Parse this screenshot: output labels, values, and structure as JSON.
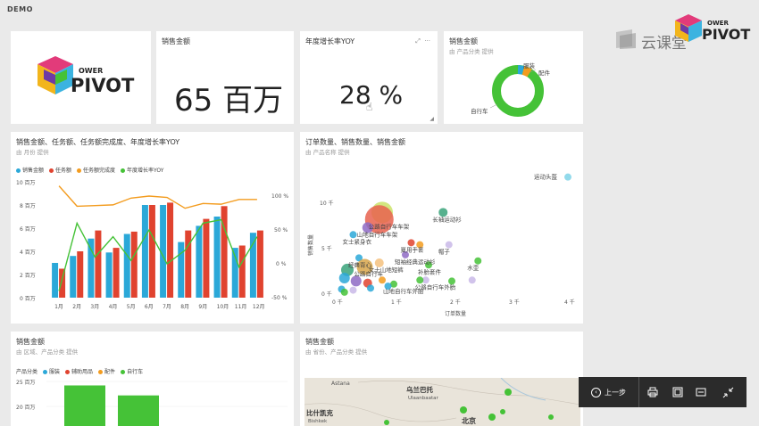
{
  "app": {
    "title": "DEMO"
  },
  "watermark": {
    "text": "云课堂",
    "brand_top": "OWER",
    "brand_main": "PIVOT",
    "brand_sub": "工坊"
  },
  "logo_tile": {
    "brand_top": "OWER",
    "brand_main": "PIVOT",
    "brand_sub": "工坊"
  },
  "kpi_sales": {
    "title": "销售金额",
    "value": "65 百万"
  },
  "kpi_growth": {
    "title": "年度增长率YOY",
    "value": "28 %"
  },
  "donut": {
    "title": "销售金额",
    "subtitle": "由 产品分类 提供",
    "labels": [
      "服装",
      "配件",
      "自行车"
    ],
    "colors": {
      "bike": "#45c237",
      "clothing": "#2ba8d8",
      "accessory": "#f39c1f"
    }
  },
  "combo": {
    "title": "销售金额、任务额、任务额完成度、年度增长率YOY",
    "subtitle": "由 月份 提供",
    "legend": [
      "销售金额",
      "任务额",
      "任务额完成度",
      "年度增长率YOY"
    ],
    "y_left_ticks": [
      "10 百万",
      "8 百万",
      "6 百万",
      "4 百万",
      "2 百万",
      "0 百万"
    ],
    "y_right_ticks": [
      "100 %",
      "50 %",
      "0 %",
      "-50 %"
    ]
  },
  "scatter": {
    "title": "订单数量、销售数量、销售金额",
    "subtitle": "由 产品名称 提供",
    "xlabel": "订单数量",
    "ylabel": "销售数量",
    "x_ticks": [
      "0 千",
      "1 千",
      "2 千",
      "3 千",
      "4 千"
    ],
    "y_ticks": [
      "10 千",
      "5 千",
      "0 千"
    ],
    "labels": [
      "运动头盔",
      "长袖运动衫",
      "公路自行车车架",
      "山地自行车车架",
      "女士紧身衣",
      "夏用手套",
      "短袖经典运动衫",
      "帽子",
      "经典背心",
      "女士山地短裤",
      "公路自行车",
      "补胎套件",
      "水壶",
      "公路自行车外胎",
      "山地自行车外胎",
      "运动水壶",
      "山地自行车"
    ]
  },
  "bar_bottom": {
    "title": "销售金额",
    "subtitle": "由 区域、产品分类 提供",
    "legend_title": "产品分类",
    "legend": [
      "服装",
      "辅助用品",
      "配件",
      "自行车"
    ],
    "y_ticks": [
      "25 百万",
      "20 百万"
    ]
  },
  "map_tile": {
    "title": "销售金额",
    "subtitle": "由 省份、产品分类 提供",
    "places": [
      "Astana",
      "乌兰巴托",
      "Ulaanbaatar",
      "比什凯克",
      "Bishkek",
      "北京"
    ]
  },
  "nav": {
    "back_label": "上一步"
  },
  "chart_data": [
    {
      "type": "bar",
      "title": "销售金额、任务额、任务额完成度、年度增长率YOY",
      "categories": [
        "1月",
        "2月",
        "3月",
        "4月",
        "5月",
        "6月",
        "7月",
        "8月",
        "9月",
        "10月",
        "11月",
        "12月"
      ],
      "ylim": [
        0,
        10
      ],
      "y2lim": [
        -50,
        100
      ],
      "series": [
        {
          "name": "销售金额",
          "kind": "bar",
          "color": "#2ba8d8",
          "values": [
            3.0,
            3.6,
            5.1,
            3.9,
            5.5,
            8.0,
            8.0,
            4.8,
            6.2,
            7.0,
            4.3,
            5.6
          ]
        },
        {
          "name": "任务额",
          "kind": "bar",
          "color": "#e0432f",
          "values": [
            2.5,
            4.0,
            5.8,
            4.3,
            5.7,
            8.0,
            8.2,
            5.8,
            6.8,
            7.9,
            4.5,
            5.8
          ]
        },
        {
          "name": "任务额完成度",
          "kind": "line",
          "color": "#f39c1f",
          "values": [
            115,
            85,
            86,
            87,
            97,
            100,
            98,
            82,
            89,
            88,
            95,
            95
          ]
        },
        {
          "name": "年度增长率YOY",
          "kind": "line",
          "color": "#45c237",
          "values": [
            -40,
            60,
            10,
            40,
            5,
            50,
            0,
            20,
            60,
            65,
            -5,
            40
          ]
        }
      ]
    },
    {
      "type": "scatter",
      "title": "订单数量、销售数量、销售金额",
      "xlabel": "订单数量",
      "ylabel": "销售数量",
      "xlim": [
        0,
        4
      ],
      "ylim": [
        0,
        12
      ],
      "points": [
        {
          "label": "运动头盔",
          "x": 4.0,
          "y": 11.5,
          "size": 4,
          "color": "#7fd4e8"
        },
        {
          "label": "长袖运动衫",
          "x": 1.85,
          "y": 8.0,
          "size": 5,
          "color": "#3aa37a"
        },
        {
          "label": "",
          "x": 0.8,
          "y": 8.0,
          "size": 12,
          "color": "#cbe36a"
        },
        {
          "label": "公路自行车车架",
          "x": 0.75,
          "y": 7.3,
          "size": 16,
          "color": "#e8624f"
        },
        {
          "label": "山地自行车车架",
          "x": 0.55,
          "y": 6.5,
          "size": 6,
          "color": "#8e6ac4"
        },
        {
          "label": "女士紧身衣",
          "x": 0.3,
          "y": 5.8,
          "size": 4,
          "color": "#2ba8d8"
        },
        {
          "label": "夏用手套",
          "x": 1.3,
          "y": 5.0,
          "size": 4,
          "color": "#e0432f"
        },
        {
          "label": "",
          "x": 1.45,
          "y": 4.8,
          "size": 4,
          "color": "#f39c1f"
        },
        {
          "label": "短袖经典运动衫",
          "x": 1.2,
          "y": 3.8,
          "size": 4,
          "color": "#8e6ac4"
        },
        {
          "label": "帽子",
          "x": 1.95,
          "y": 4.8,
          "size": 4,
          "color": "#c9b8e8"
        },
        {
          "label": "经典背心",
          "x": 0.4,
          "y": 3.5,
          "size": 4,
          "color": "#2ba8d8"
        },
        {
          "label": "女士山地短裤",
          "x": 0.75,
          "y": 3.0,
          "size": 5,
          "color": "#f5c17e"
        },
        {
          "label": "水壶",
          "x": 2.45,
          "y": 3.2,
          "size": 4,
          "color": "#45c237"
        },
        {
          "label": "补胎套件",
          "x": 1.6,
          "y": 2.8,
          "size": 4,
          "color": "#45c237"
        },
        {
          "label": "公路自行车",
          "x": 0.5,
          "y": 2.6,
          "size": 9,
          "color": "#d8a64a"
        },
        {
          "label": "",
          "x": 0.2,
          "y": 2.3,
          "size": 7,
          "color": "#3aa37a"
        },
        {
          "label": "",
          "x": 0.15,
          "y": 1.5,
          "size": 6,
          "color": "#2ba8d8"
        },
        {
          "label": "",
          "x": 0.35,
          "y": 1.2,
          "size": 6,
          "color": "#8e6ac4"
        },
        {
          "label": "",
          "x": 0.55,
          "y": 1.0,
          "size": 5,
          "color": "#e0432f"
        },
        {
          "label": "公路自行车外胎",
          "x": 1.55,
          "y": 1.3,
          "size": 4,
          "color": "#c9b8e8"
        },
        {
          "label": "",
          "x": 1.45,
          "y": 1.3,
          "size": 4,
          "color": "#45c237"
        },
        {
          "label": "",
          "x": 2.0,
          "y": 1.2,
          "size": 4,
          "color": "#45c237"
        },
        {
          "label": "",
          "x": 2.35,
          "y": 1.3,
          "size": 4,
          "color": "#c9b8e8"
        },
        {
          "label": "山地自行车外胎",
          "x": 1.0,
          "y": 0.9,
          "size": 4,
          "color": "#45c237"
        },
        {
          "label": "",
          "x": 0.9,
          "y": 0.7,
          "size": 4,
          "color": "#2ba8d8"
        },
        {
          "label": "",
          "x": 0.8,
          "y": 1.3,
          "size": 4,
          "color": "#f39c1f"
        },
        {
          "label": "",
          "x": 0.1,
          "y": 0.4,
          "size": 4,
          "color": "#2ba8d8"
        },
        {
          "label": "",
          "x": 0.15,
          "y": 0.1,
          "size": 4,
          "color": "#45c237"
        },
        {
          "label": "",
          "x": 0.3,
          "y": 0.3,
          "size": 4,
          "color": "#c9b8e8"
        },
        {
          "label": "",
          "x": 0.6,
          "y": 0.5,
          "size": 4,
          "color": "#2ba8d8"
        }
      ]
    },
    {
      "type": "bar",
      "title": "销售金额",
      "categories": [
        "",
        ""
      ],
      "ylim": [
        0,
        25
      ],
      "series": [
        {
          "name": "自行车",
          "color": "#45c237",
          "values": [
            23,
            18
          ]
        }
      ]
    }
  ]
}
